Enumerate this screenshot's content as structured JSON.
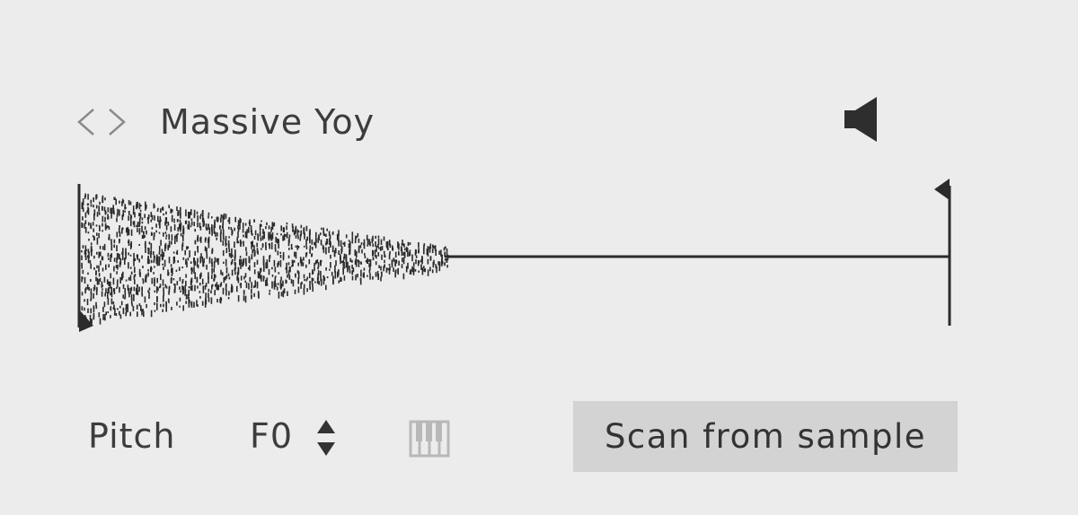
{
  "header": {
    "sample_name": "Massive Yoy",
    "prev_icon": "chevron-left-icon",
    "next_icon": "chevron-right-icon",
    "speaker_icon": "speaker-icon"
  },
  "waveform": {
    "start_marker_icon": "start-marker-icon",
    "end_marker_icon": "end-marker-icon"
  },
  "controls": {
    "pitch_label": "Pitch",
    "pitch_value": "F0",
    "stepper_icon": "stepper-icon",
    "keyboard_icon": "piano-keys-icon",
    "scan_label": "Scan from sample"
  },
  "colors": {
    "background": "#ececec",
    "text": "#3c3c3c",
    "waveform": "#2b2b2b",
    "button_bg": "#d3d3d3"
  }
}
